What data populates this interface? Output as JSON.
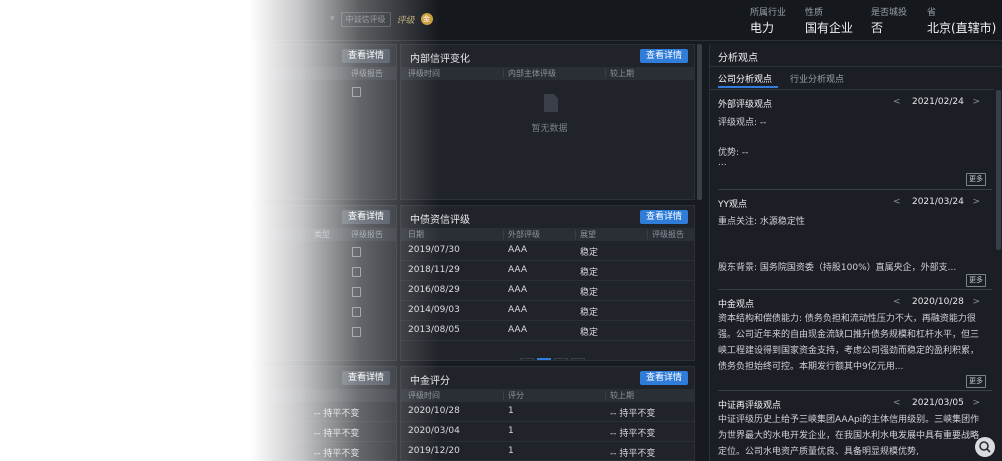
{
  "topbar": {
    "widget_btn": "中诚信评级",
    "logo": "评级",
    "coin": "金",
    "fields": [
      {
        "label": "所属行业",
        "value": "电力"
      },
      {
        "label": "性质",
        "value": "国有企业"
      },
      {
        "label": "是否城投",
        "value": "否"
      },
      {
        "label": "省",
        "value": "北京(直辖市)"
      }
    ]
  },
  "left_panels": {
    "top": {
      "view_label": "查看详情",
      "report_col": "评级报告"
    },
    "mid": {
      "view_label": "查看详情",
      "report_col": "评级报告",
      "type_col": "类型"
    },
    "bot": {
      "view_label": "查看详情"
    }
  },
  "internal_rating": {
    "title": "内部信评变化",
    "view_label": "查看详情",
    "columns": [
      "评级时间",
      "内部主体评级",
      "较上期"
    ],
    "empty_text": "暂无数据"
  },
  "cbrating": {
    "title": "中债资信评级",
    "view_label": "查看详情",
    "columns": [
      "日期",
      "外部评级",
      "展望",
      "评级报告"
    ],
    "rows": [
      {
        "date": "2019/07/30",
        "rating": "AAA",
        "outlook": "稳定"
      },
      {
        "date": "2018/11/29",
        "rating": "AAA",
        "outlook": "稳定"
      },
      {
        "date": "2016/08/29",
        "rating": "AAA",
        "outlook": "稳定"
      },
      {
        "date": "2014/09/03",
        "rating": "AAA",
        "outlook": "稳定"
      },
      {
        "date": "2013/08/05",
        "rating": "AAA",
        "outlook": "稳定"
      }
    ],
    "pager": {
      "prev": "<",
      "pages": [
        "1",
        "2"
      ],
      "next": ">"
    }
  },
  "cicc": {
    "title": "中金评分",
    "view_label": "查看详情",
    "columns": [
      "评级时间",
      "评分",
      "较上期"
    ],
    "rows": [
      {
        "date": "2020/10/28",
        "score": "1",
        "change": "-- 持平不变"
      },
      {
        "date": "2020/03/04",
        "score": "1",
        "change": "-- 持平不变"
      },
      {
        "date": "2019/12/20",
        "score": "1",
        "change": "-- 持平不变"
      }
    ],
    "left_change": [
      "-- 持平不变",
      "-- 持平不变",
      "-- 持平不变"
    ]
  },
  "analysis": {
    "title": "分析观点",
    "tabs": [
      "公司分析观点",
      "行业分析观点"
    ],
    "more_label": "更多",
    "sections": [
      {
        "title": "外部评级观点",
        "prev": "<",
        "date": "2021/02/24",
        "next": ">",
        "lines": [
          "评级观点:  --",
          "优势:  --",
          "..."
        ]
      },
      {
        "title": "YY观点",
        "prev": "<",
        "date": "2021/03/24",
        "next": ">",
        "lines": [
          "重点关注:  水源稳定性",
          "股东背景:  国务院国资委（持股100%）直属央企，外部支..."
        ]
      },
      {
        "title": "中金观点",
        "prev": "<",
        "date": "2020/10/28",
        "next": ">",
        "para": "资本结构和偿债能力:  债务负担和流动性压力不大，再融资能力很强。公司近年来的自由现金流缺口推升债务规模和杠杆水平，但三峡工程建设得到国家资金支持，考虑公司强劲而稳定的盈利积累，债务负担始终可控。本期发行额其中9亿元用..."
      },
      {
        "title": "中证再评级观点",
        "prev": "<",
        "date": "2021/03/05",
        "next": ">",
        "para": "中证评级历史上给予三峡集团AAApi的主体信用级别。三峡集团作为世界最大的水电开发企业，在我国水利水电发展中具有重要战略定位。公司水电资产质量优良、具备明显规模优势,"
      }
    ]
  }
}
